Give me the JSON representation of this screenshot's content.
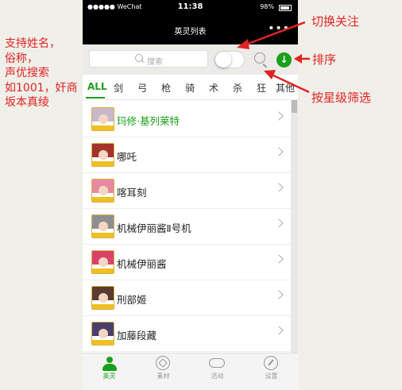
{
  "annotations": {
    "left_note_lines": [
      "支持姓名，",
      "俗称，",
      "声优搜索",
      "如1001，奸商",
      "坂本真绫"
    ],
    "toggle_follow": "切换关注",
    "sort": "排序",
    "star_filter": "按星级筛选"
  },
  "statusbar": {
    "signal": "●●●●● WeChat",
    "time": "11:38",
    "battery": "98%"
  },
  "navbar": {
    "title": "英灵列表",
    "more": "•••"
  },
  "search": {
    "placeholder": "搜索"
  },
  "tabs": [
    "ALL",
    "剑",
    "弓",
    "枪",
    "骑",
    "术",
    "杀",
    "狂",
    "其他"
  ],
  "servants": [
    {
      "name": "玛修·基列莱特",
      "highlight": true
    },
    {
      "name": "哪吒",
      "highlight": false
    },
    {
      "name": "喀耳刻",
      "highlight": false
    },
    {
      "name": "机械伊丽酱Ⅱ号机",
      "highlight": false
    },
    {
      "name": "机械伊丽酱",
      "highlight": false
    },
    {
      "name": "刑部姬",
      "highlight": false
    },
    {
      "name": "加藤段藏",
      "highlight": false
    }
  ],
  "tabbar": [
    {
      "label": "英灵",
      "active": true
    },
    {
      "label": "素材",
      "active": false
    },
    {
      "label": "活动",
      "active": false
    },
    {
      "label": "设置",
      "active": false
    }
  ],
  "colors": {
    "accent": "#1aa01a",
    "annotation": "#e02424",
    "header": "#000000"
  }
}
